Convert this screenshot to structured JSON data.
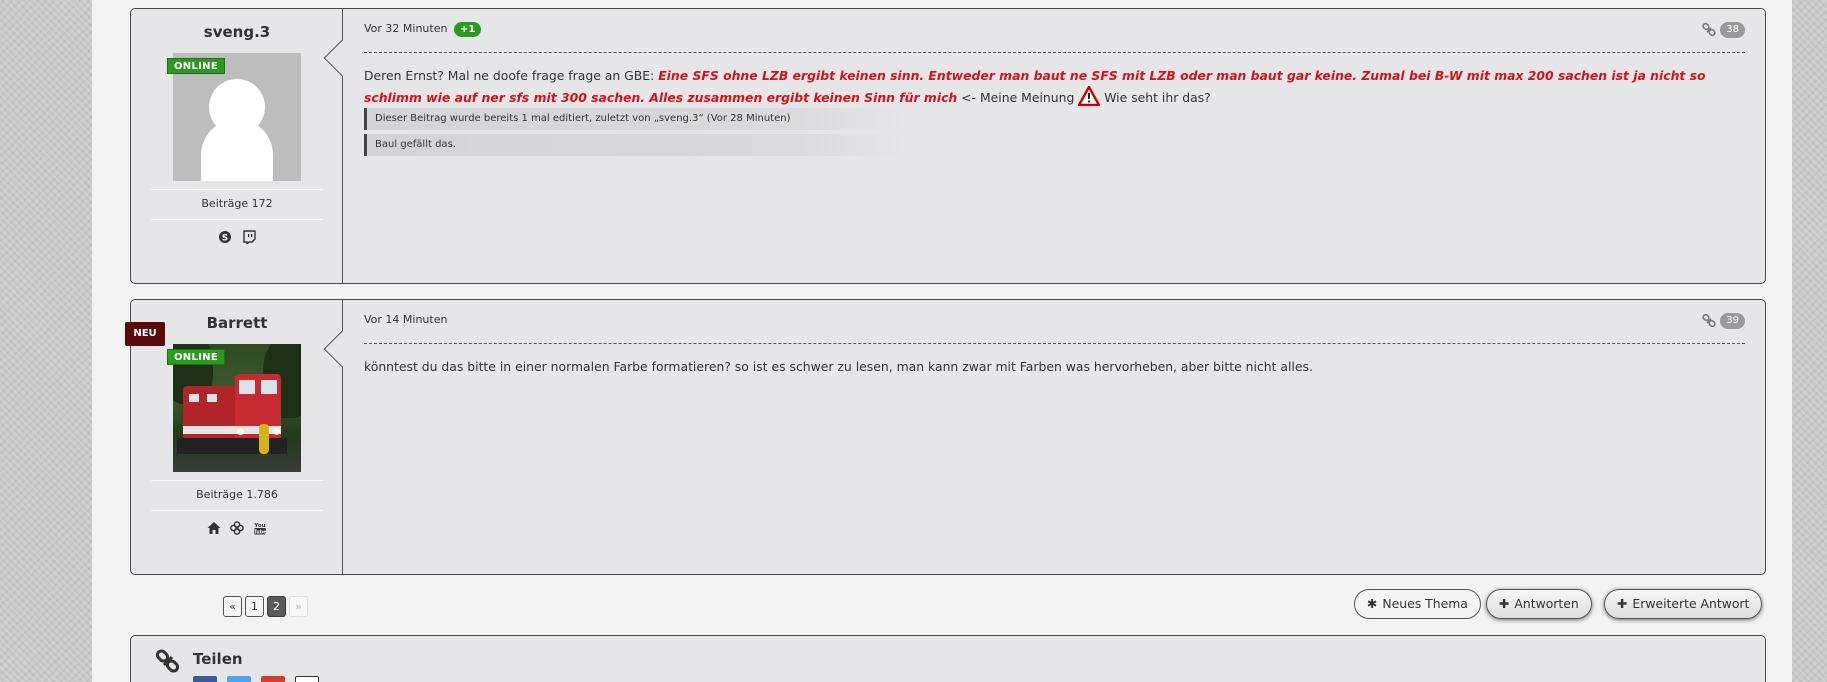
{
  "posts": [
    {
      "username": "sveng.3",
      "online_label": "ONLINE",
      "stats_label": "Beiträge",
      "stats_value": "172",
      "contact_icons": [
        "skype-icon",
        "twitch-icon"
      ],
      "time": "Vor 32 Minuten",
      "like_badge": "+1",
      "post_number": "38",
      "message_start": "Deren Ernst? Mal ne doofe frage frage an GBE: ",
      "message_highlight": "Eine SFS ohne LZB ergibt keinen sinn. Entweder man baut ne SFS mit LZB oder man baut gar keine. Zumal bei B-W mit max 200 sachen ist ja nicht so schlimm wie auf ner sfs mit 300 sachen. Alles zusammen ergibt keinen Sinn für mich",
      "message_mid": " <- Meine Meinung ",
      "message_end": " Wie seht ihr das?",
      "edit_notice": "Dieser Beitrag wurde bereits 1 mal editiert, zuletzt von „sveng.3“ (Vor 28 Minuten)",
      "like_notice": "Baul gefällt das."
    },
    {
      "username": "Barrett",
      "new_badge": "NEU",
      "online_label": "ONLINE",
      "stats_label": "Beiträge",
      "stats_value": "1.786",
      "contact_icons": [
        "home-icon",
        "flower-icon",
        "youtube-icon"
      ],
      "time": "Vor 14 Minuten",
      "post_number": "39",
      "message": "könntest du das bitte in einer normalen Farbe formatieren? so ist es schwer zu lesen, man kann zwar mit Farben was hervorheben, aber bitte nicht alles."
    }
  ],
  "pagination": {
    "first": "«",
    "pages": [
      "1",
      "2"
    ],
    "current": "2",
    "next": "»"
  },
  "buttons": {
    "new_thread_icon": "✱",
    "new_thread": "Neues Thema",
    "reply_icon": "✚",
    "reply": "Antworten",
    "advanced_reply_icon": "✚",
    "advanced_reply": "Erweiterte Antwort"
  },
  "share": {
    "title": "Teilen"
  },
  "colors": {
    "online_green": "#2a9b1f",
    "highlight_red": "#d1141a",
    "new_badge": "#5b0a0a",
    "panel_bg": "#e6e6e8"
  }
}
